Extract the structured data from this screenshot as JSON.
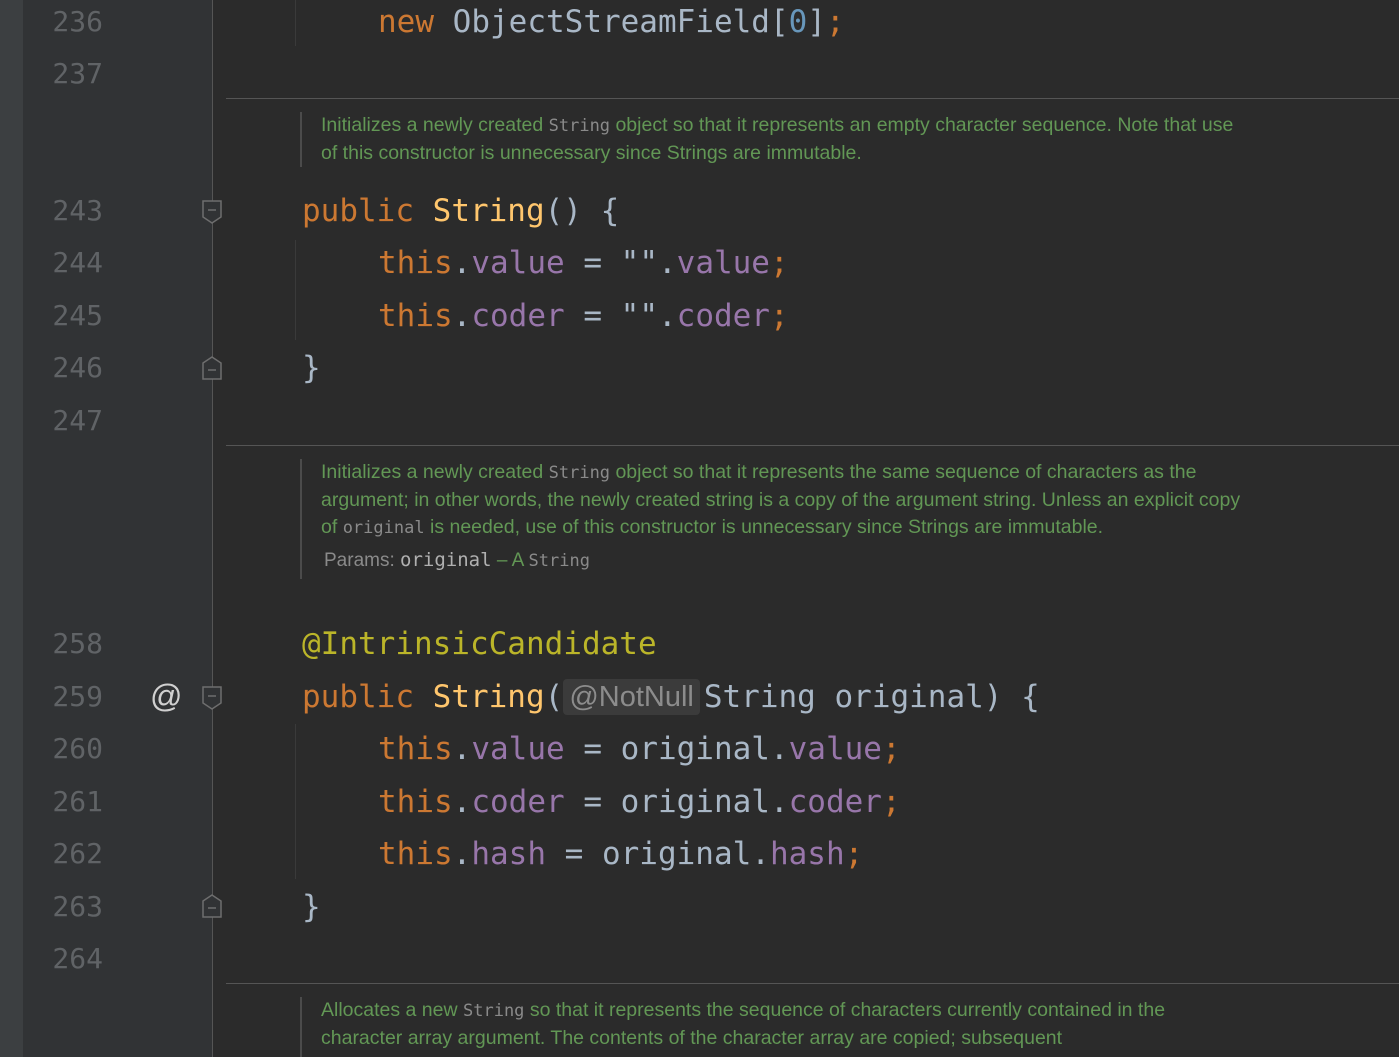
{
  "gutter": {
    "line_numbers": [
      {
        "num": "236"
      },
      {
        "num": "237"
      },
      {
        "num": "243"
      },
      {
        "num": "244"
      },
      {
        "num": "245"
      },
      {
        "num": "246"
      },
      {
        "num": "247"
      },
      {
        "num": "258"
      },
      {
        "num": "259"
      },
      {
        "num": "260"
      },
      {
        "num": "261"
      },
      {
        "num": "262"
      },
      {
        "num": "263"
      },
      {
        "num": "264"
      }
    ],
    "marker_icon": "@"
  },
  "code": {
    "l236": {
      "kw_new": "new",
      "type": "ObjectStreamField",
      "open": "[",
      "num": "0",
      "close": "]",
      "semi": ";"
    },
    "l243": {
      "kw": "public",
      "name": "String",
      "rest": "() {"
    },
    "l244": {
      "this": "this",
      "dot": ".",
      "field": "value",
      "eq": " = ",
      "str": "\"\"",
      "dot2": ".",
      "field2": "value",
      "semi": ";"
    },
    "l245": {
      "this": "this",
      "dot": ".",
      "field": "coder",
      "eq": " = ",
      "str": "\"\"",
      "dot2": ".",
      "field2": "coder",
      "semi": ";"
    },
    "l246": {
      "brace": "}"
    },
    "l258": {
      "annotation": "@IntrinsicCandidate"
    },
    "l259": {
      "kw": "public",
      "name": "String",
      "paren": "(",
      "inlay": "@NotNull",
      "params": "String original) {"
    },
    "l260": {
      "this": "this",
      "dot": ".",
      "field": "value",
      "eq": " = ",
      "var": "original",
      "dot2": ".",
      "field2": "value",
      "semi": ";"
    },
    "l261": {
      "this": "this",
      "dot": ".",
      "field": "coder",
      "eq": " = ",
      "var": "original",
      "dot2": ".",
      "field2": "coder",
      "semi": ";"
    },
    "l262": {
      "this": "this",
      "dot": ".",
      "field": "hash",
      "eq": " = ",
      "var": "original",
      "dot2": ".",
      "field2": "hash",
      "semi": ";"
    },
    "l263": {
      "brace": "}"
    }
  },
  "docs": {
    "doc1": {
      "a": "Initializes a newly created ",
      "code": "String",
      "b": " object so that it represents an empty character sequence. Note that use of this constructor is unnecessary since Strings are immutable."
    },
    "doc2": {
      "a": "Initializes a newly created ",
      "code1": "String",
      "b": " object so that it represents the same sequence of characters as the argument; in other words, the newly created string is a copy of the argument string. Unless an explicit copy of ",
      "code2": "original",
      "c": " is needed, use of this constructor is unnecessary since Strings are immutable.",
      "params_label": "Params:",
      "param_name": "original",
      "param_dash": " – A ",
      "param_type": "String"
    },
    "doc3": {
      "a": "Allocates a new ",
      "code": "String",
      "b": " so that it represents the sequence of characters currently contained in the character array argument. The contents of the character array are copied; subsequent"
    }
  },
  "colors": {
    "background": "#2b2b2b",
    "gutter": "#313335",
    "keyword": "#cc7832",
    "field": "#9876aa",
    "method": "#ffc66d",
    "annotation": "#bbb529",
    "doc_text": "#629755",
    "number": "#6897bb"
  }
}
